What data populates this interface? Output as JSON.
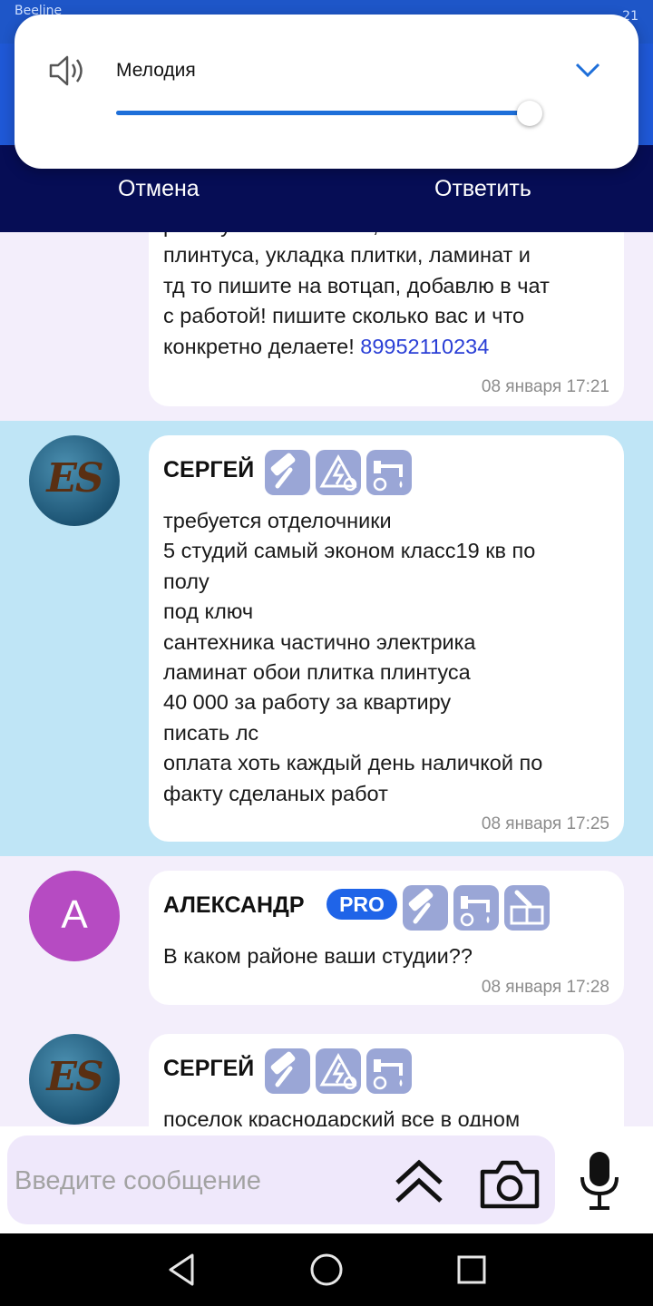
{
  "status_bar": {
    "carrier": "Beeline",
    "time": "21"
  },
  "volume_panel": {
    "label": "Мелодия",
    "level_fraction": 1.0,
    "speaker_icon": "speaker-icon",
    "collapse_icon": "chevron-down-icon",
    "accent_color": "#1e6fd9"
  },
  "action_bar": {
    "cancel_label": "Отмена",
    "reply_label": "Ответить"
  },
  "messages": [
    {
      "lines": [
        "работу по шпатлевки, поклейки",
        "плинтуса, укладка плитки, ламинат и",
        "тд то пишите на вотцап, добавлю в чат",
        "с работой! пишите сколько вас и что"
      ],
      "last_line_prefix": "конкретно делаете! ",
      "phone": "89952110234",
      "time": "08 января 17:21"
    },
    {
      "author": "СЕРГЕЙ",
      "avatar_text": "ES",
      "badges": [
        "paint-roller-icon",
        "electric-icon",
        "plumbing-icon"
      ],
      "lines": [
        "требуется отделочники",
        "5 студий самый эконом класс19 кв по",
        "полу",
        "под ключ",
        "сантехника частично электрика",
        "ламинат обои плитка плинтуса",
        "40 000 за работу за квартиру",
        "писать лс",
        "оплата хоть каждый день наличкой по",
        "факту сделаных работ"
      ],
      "time": "08 января 17:25"
    },
    {
      "author": "АЛЕКСАНДР",
      "avatar_text": "А",
      "pro_label": "PRO",
      "badges": [
        "paint-roller-icon",
        "plumbing-icon",
        "tile-icon"
      ],
      "lines": [
        "В каком районе ваши студии??"
      ],
      "time": "08 января 17:28"
    },
    {
      "author": "СЕРГЕЙ",
      "avatar_text": "ES",
      "badges": [
        "paint-roller-icon",
        "electric-icon",
        "plumbing-icon"
      ],
      "lines": [
        "поселок краснодарский все в одном"
      ]
    }
  ],
  "input": {
    "placeholder": "Введите сообщение"
  },
  "colors": {
    "header": "#1f58d6",
    "action_bar": "#060d55",
    "highlight_row": "#bfe5f6",
    "row": "#f3eefb",
    "avatar_a": "#b64bc2",
    "pro_badge": "#1f64e8",
    "badge": "#9aa6d6"
  }
}
